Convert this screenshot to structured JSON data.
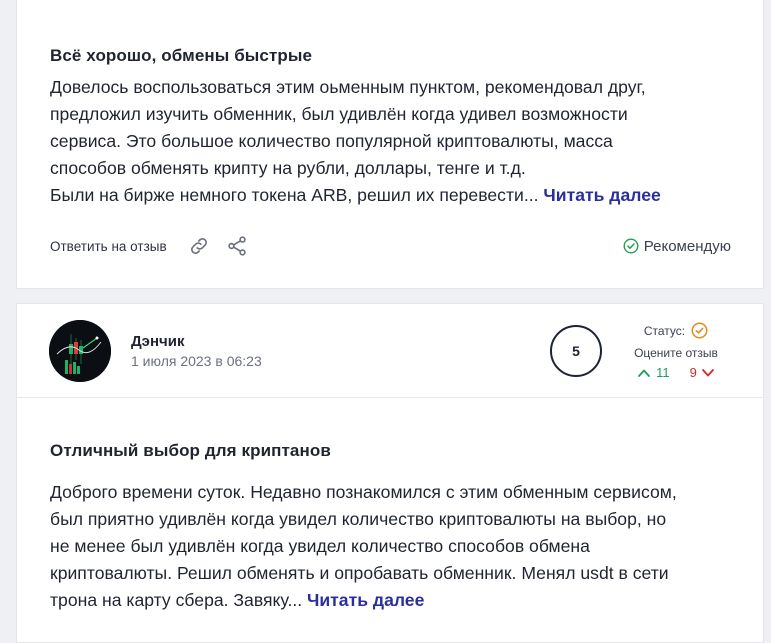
{
  "review1": {
    "title": "Всё хорошо, обмены быстрые",
    "body_lines": [
      "Довелось воспользоваться этим оьменным пунктом, рекомендовал друг,",
      "предложил изучить обменник, был удивлён когда удивел возможности",
      "сервиса. Это большое количество популярной криптовалюты, масса",
      "способов обменять крипту на рубли, доллары, тенге и т.д.",
      "Были на бирже немного токена ARB, решил их перевести..."
    ],
    "read_more": "Читать далее",
    "reply_label": "Ответить на отзыв",
    "recommend_label": "Рекомендую",
    "icons": {
      "link": "link-icon",
      "share": "share-icon",
      "recommend": "check-circle-icon"
    }
  },
  "review2": {
    "author": "Дэнчик",
    "date": "1 июля 2023 в 06:23",
    "rating": "5",
    "status_label": "Статус:",
    "rate_label": "Оцените отзыв",
    "votes_up": "11",
    "votes_down": "9",
    "title": "Отличный выбор для криптанов",
    "body_lines": [
      "Доброго времени суток. Недавно познакомился с этим обменным сервисом,",
      "был приятно удивлён когда увидел количество криптовалюты на выбор, но",
      "не менее был удивлён когда увидел количество способов обмена",
      "криптовалюты. Решил обменять и опробавать обменник. Менял usdt в сети",
      "трона на карту сбера. Завяку..."
    ],
    "read_more": "Читать далее",
    "icons": {
      "status": "status-check-icon",
      "up": "arrow-up-icon",
      "down": "arrow-down-icon",
      "avatar": "avatar-chart-image"
    }
  },
  "colors": {
    "accent_link": "#2b2f9c",
    "positive": "#1e9d62",
    "negative": "#d22a2a",
    "status_orange": "#e08a1e",
    "recommend_green": "#2f9a5c"
  }
}
